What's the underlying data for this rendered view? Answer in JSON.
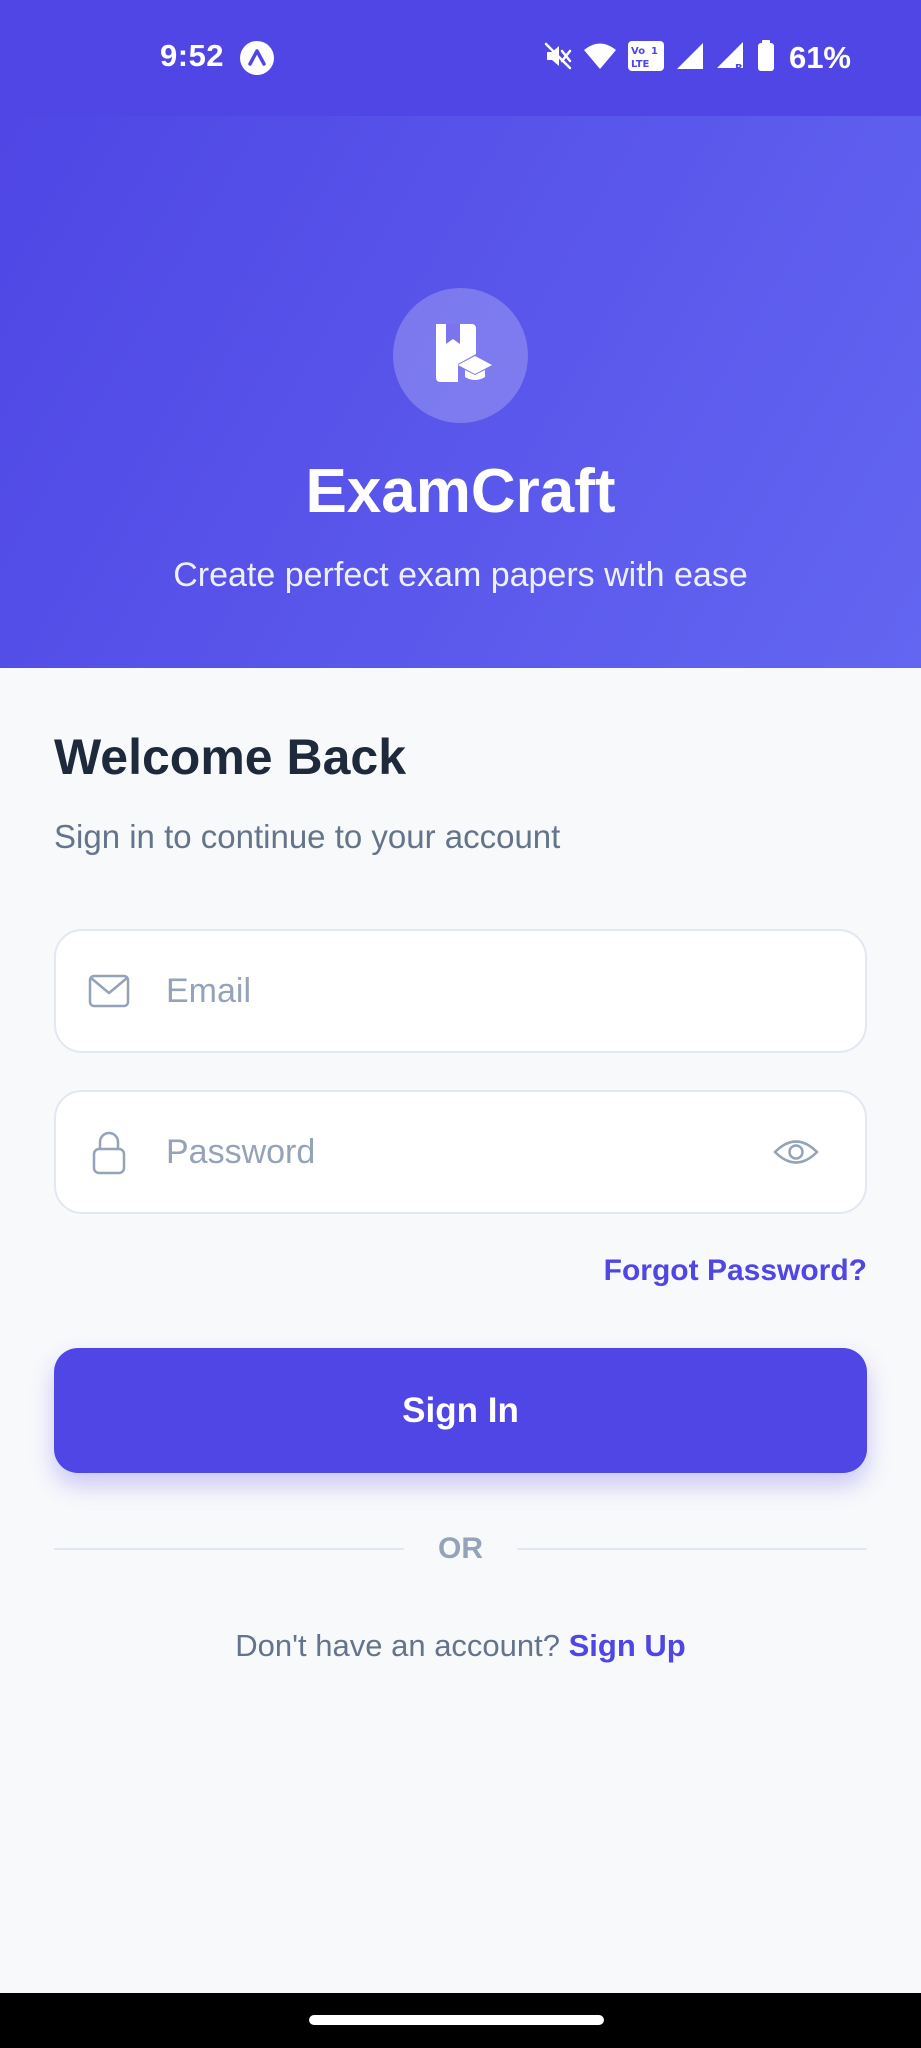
{
  "status_bar": {
    "time": "9:52",
    "battery_text": "61%",
    "icons": [
      "expo-icon",
      "mute-icon",
      "wifi-icon",
      "volte-icon",
      "signal-icon",
      "signal-roaming-icon",
      "battery-icon"
    ]
  },
  "hero": {
    "logo_icon": "book-graduation-cap-icon",
    "title": "ExamCraft",
    "subtitle": "Create perfect exam papers with ease"
  },
  "form": {
    "title": "Welcome Back",
    "subtitle": "Sign in to continue to your account",
    "email": {
      "placeholder": "Email",
      "value": "",
      "icon": "mail-icon"
    },
    "password": {
      "placeholder": "Password",
      "value": "",
      "icon": "lock-icon",
      "toggle_icon": "eye-icon"
    },
    "forgot_password": "Forgot Password?",
    "sign_in": "Sign In",
    "divider": "OR",
    "signup_prompt": "Don't have an account?",
    "signup_link": "Sign Up"
  },
  "colors": {
    "primary": "#4f46e5",
    "primary_light": "#6366f1",
    "heading": "#1e293b",
    "muted": "#64748b",
    "placeholder": "#94a3b8",
    "border": "#e2e8f0",
    "background": "#f8f9fb"
  }
}
